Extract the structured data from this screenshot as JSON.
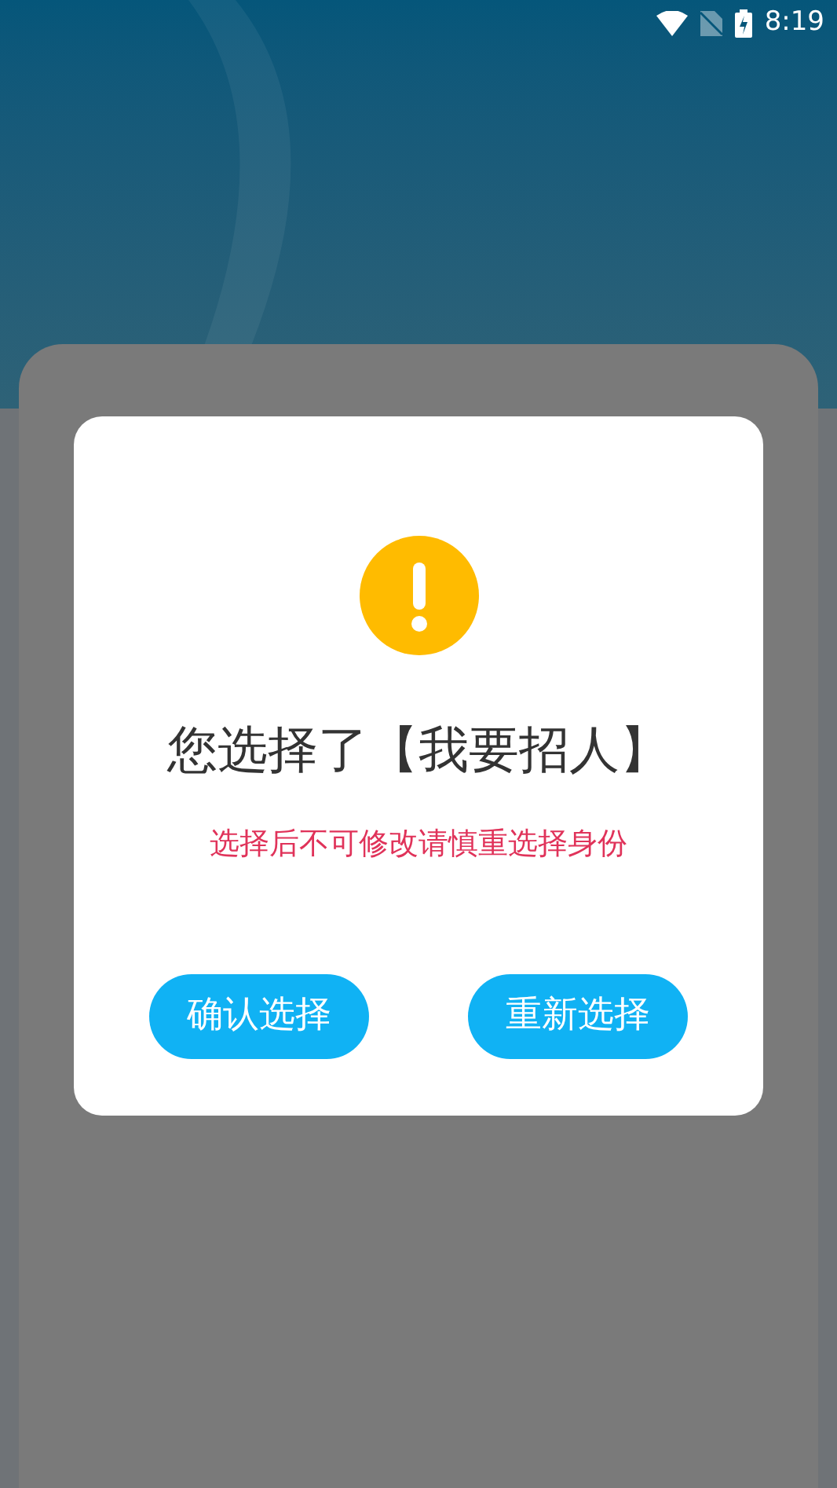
{
  "status_bar": {
    "time": "8:19"
  },
  "dialog": {
    "title": "您选择了【我要招人】",
    "message": "选择后不可修改请慎重选择身份",
    "buttons": [
      {
        "label": "确认选择"
      },
      {
        "label": "重新选择"
      }
    ]
  }
}
